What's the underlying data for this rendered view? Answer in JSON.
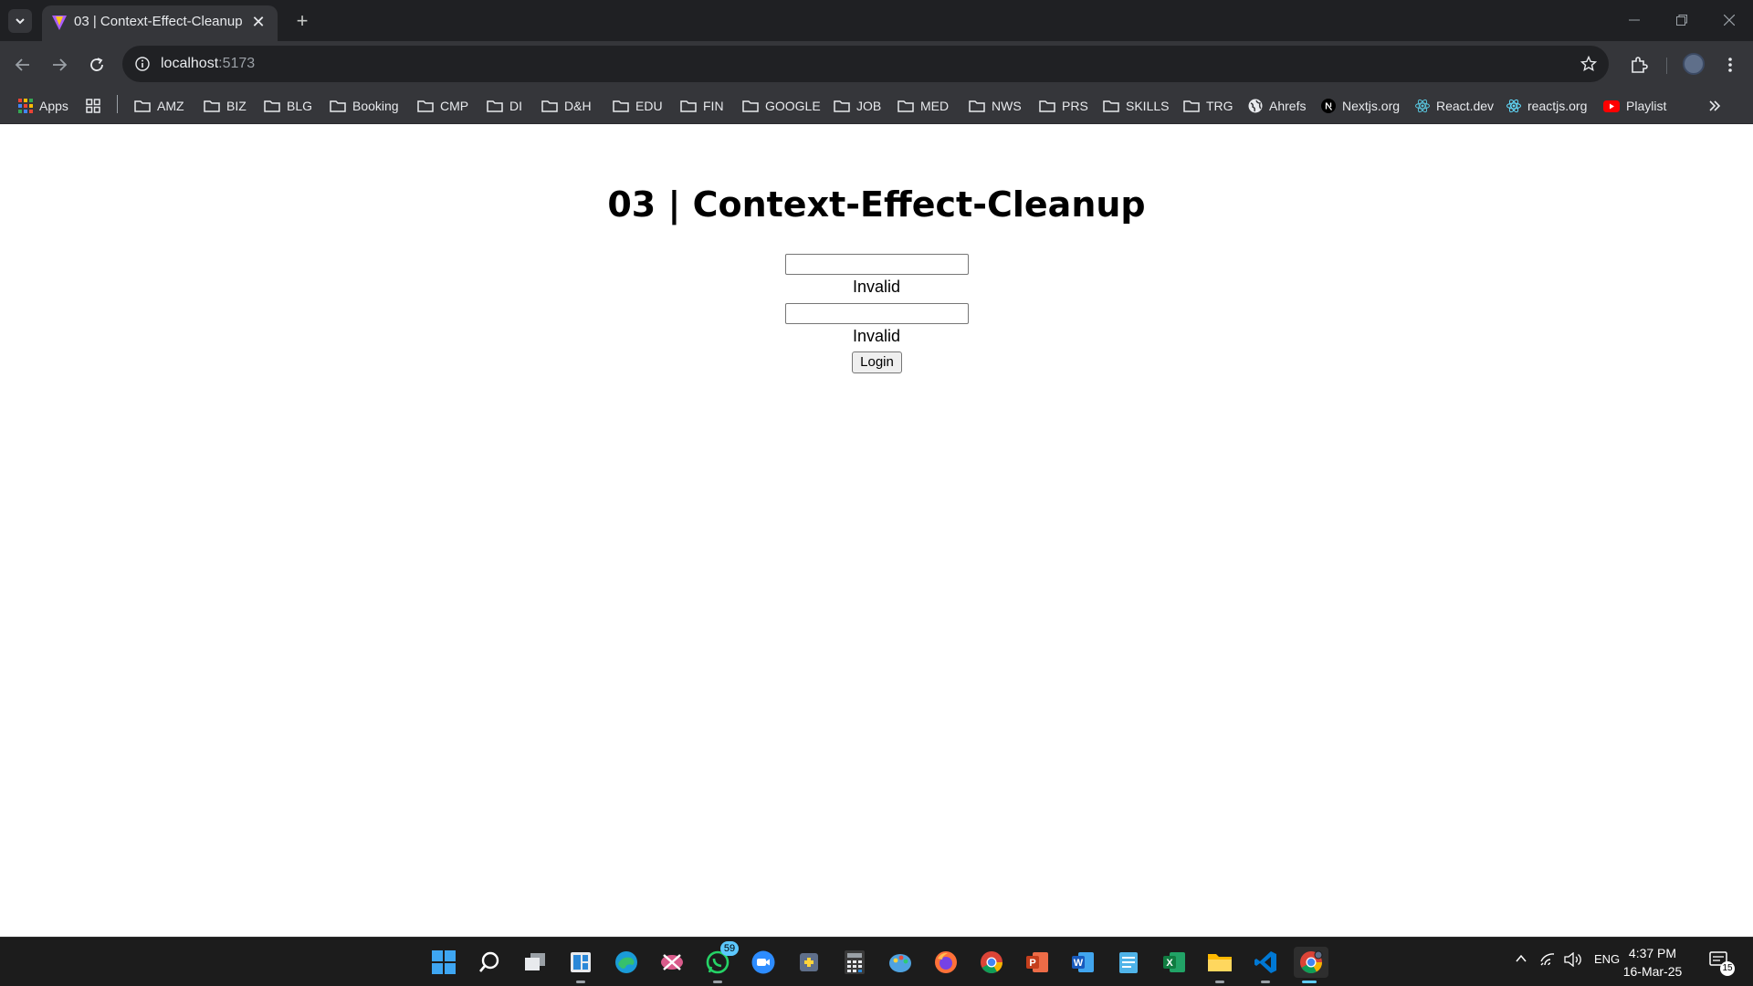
{
  "browser": {
    "tab": {
      "title": "03 | Context-Effect-Cleanup",
      "favicon": "vite-logo-icon"
    },
    "url": {
      "host": "localhost",
      "port": ":5173"
    },
    "bookmarks": [
      {
        "label": "Apps",
        "icon": "apps-grid-icon"
      },
      {
        "label": "",
        "icon": "tab-groups-icon"
      },
      {
        "label": "AMZ",
        "icon": "folder-icon"
      },
      {
        "label": "BIZ",
        "icon": "folder-icon"
      },
      {
        "label": "BLG",
        "icon": "folder-icon"
      },
      {
        "label": "Booking",
        "icon": "folder-icon"
      },
      {
        "label": "CMP",
        "icon": "folder-icon"
      },
      {
        "label": "DI",
        "icon": "folder-icon"
      },
      {
        "label": "D&H",
        "icon": "folder-icon"
      },
      {
        "label": "EDU",
        "icon": "folder-icon"
      },
      {
        "label": "FIN",
        "icon": "folder-icon"
      },
      {
        "label": "GOOGLE",
        "icon": "folder-icon"
      },
      {
        "label": "JOB",
        "icon": "folder-icon"
      },
      {
        "label": "MED",
        "icon": "folder-icon"
      },
      {
        "label": "NWS",
        "icon": "folder-icon"
      },
      {
        "label": "PRS",
        "icon": "folder-icon"
      },
      {
        "label": "SKILLS",
        "icon": "folder-icon"
      },
      {
        "label": "TRG",
        "icon": "folder-icon"
      },
      {
        "label": "Ahrefs",
        "icon": "globe-icon"
      },
      {
        "label": "Nextjs.org",
        "icon": "nextjs-icon"
      },
      {
        "label": "React.dev",
        "icon": "react-icon"
      },
      {
        "label": "reactjs.org",
        "icon": "react-icon"
      },
      {
        "label": "Playlist",
        "icon": "youtube-icon"
      }
    ]
  },
  "page": {
    "heading": "03 | Context-Effect-Cleanup",
    "email_field": {
      "value": "",
      "placeholder": ""
    },
    "email_message": "Invalid",
    "password_field": {
      "value": "",
      "placeholder": ""
    },
    "password_message": "Invalid",
    "login_label": "Login"
  },
  "taskbar": {
    "apps": [
      "windows-start-icon",
      "search-icon",
      "task-view-icon",
      "widgets-icon",
      "edge-icon",
      "snipping-tool-icon",
      "whatsapp-icon",
      "zoom-icon",
      "python-icon",
      "calculator-icon",
      "paint-icon",
      "firefox-icon",
      "chrome-icon",
      "powerpoint-icon",
      "word-icon",
      "notepad-icon",
      "excel-icon",
      "file-explorer-icon",
      "vscode-icon",
      "chrome-dev-icon"
    ],
    "whatsapp_badge": "59",
    "tray": {
      "language": "ENG"
    },
    "clock": {
      "time": "4:37 PM",
      "date": "16-Mar-25"
    },
    "notification_count": "15"
  },
  "colors": {
    "chrome_dark": "#35363a",
    "titlebar": "#1f2023",
    "omnibox": "#202124",
    "taskbar": "#1c1c1c",
    "accent": "#60cdff"
  }
}
